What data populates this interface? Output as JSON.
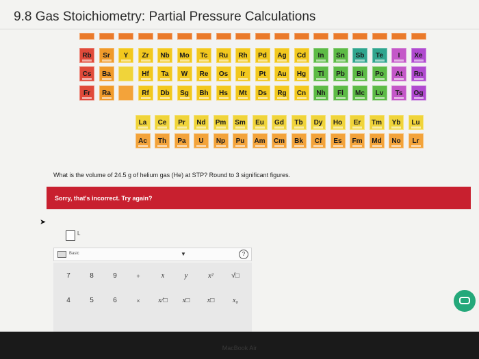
{
  "header": {
    "title": "9.8 Gas Stoichiometry: Partial Pressure Calculations"
  },
  "periodic_table": {
    "visible_symbols": [
      "Rb",
      "Sr",
      "Y",
      "Zr",
      "Nb",
      "Mo",
      "Tc",
      "Ru",
      "Rh",
      "Pd",
      "Ag",
      "Cd",
      "In",
      "Sn",
      "Sb",
      "Te",
      "I",
      "Xe",
      "Cs",
      "Ba",
      "Hf",
      "Ta",
      "W",
      "Re",
      "Os",
      "Ir",
      "Pt",
      "Au",
      "Hg",
      "Tl",
      "Pb",
      "Bi",
      "Po",
      "At",
      "Rn",
      "Fr",
      "Ra",
      "Rf",
      "Db",
      "Sg",
      "Bh",
      "Hs",
      "Mt",
      "Ds",
      "Rg",
      "Cn",
      "Nh",
      "Fl",
      "Mc",
      "Lv",
      "Ts",
      "Og"
    ],
    "lanthanides": [
      "La",
      "Ce",
      "Pr",
      "Nd",
      "Pm",
      "Sm",
      "Eu",
      "Gd",
      "Tb",
      "Dy",
      "Ho",
      "Er",
      "Tm",
      "Yb",
      "Lu"
    ],
    "actinides": [
      "Ac",
      "Th",
      "Pa",
      "U",
      "Np",
      "Pu",
      "Am",
      "Cm",
      "Bk",
      "Cf",
      "Es",
      "Fm",
      "Md",
      "No",
      "Lr"
    ]
  },
  "question": {
    "text": "What is the volume of 24.5 g of helium gas (He) at STP? Round to 3 significant figures."
  },
  "feedback": {
    "text": "Sorry, that's incorrect. Try again?"
  },
  "answer": {
    "unit_label": "L"
  },
  "keypad": {
    "mode_label": "Basic",
    "help_glyph": "?",
    "keys": [
      "7",
      "8",
      "9",
      "+",
      "x",
      "y",
      "x²",
      "√□",
      "4",
      "5",
      "6",
      "×",
      "x/□",
      "x□",
      "x□",
      "x₀"
    ]
  },
  "bezel": {
    "text": "MacBook Air"
  }
}
